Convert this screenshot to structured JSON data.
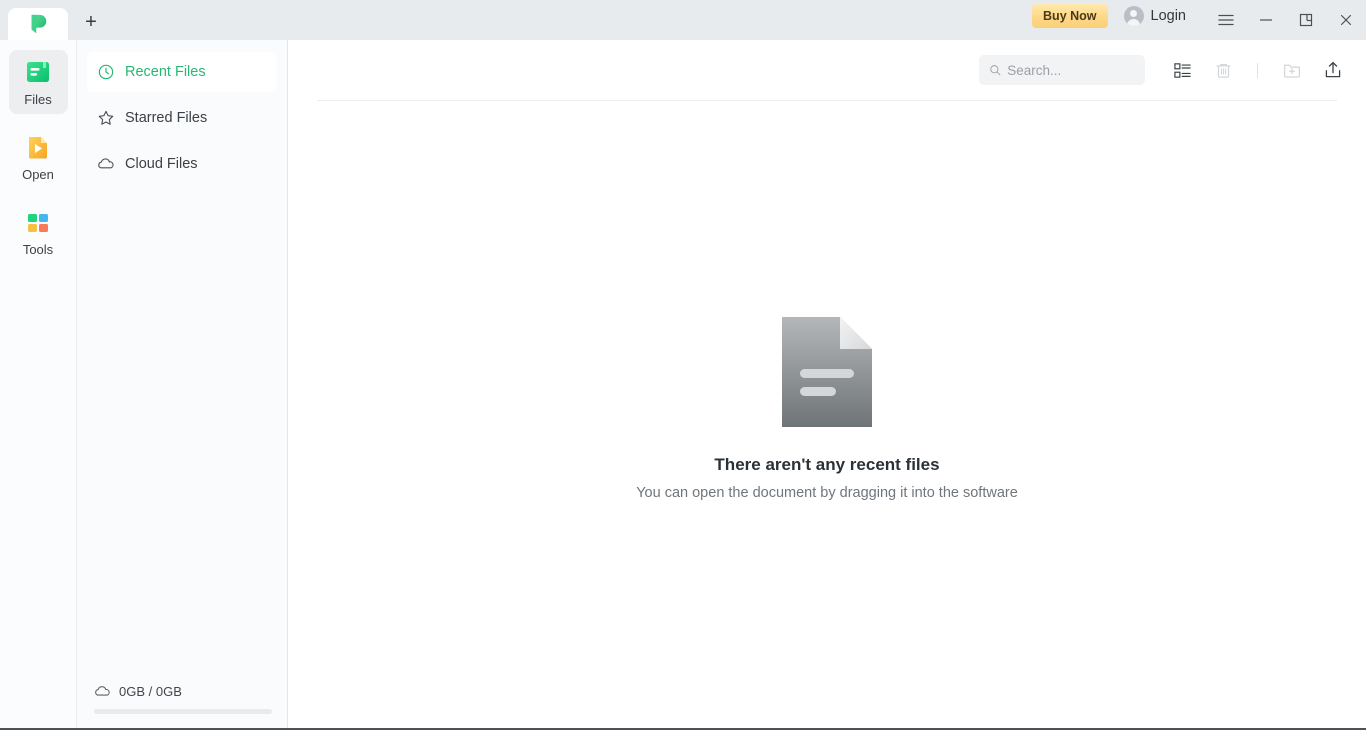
{
  "titlebar": {
    "tab_logo_name": "app-logo",
    "new_tab_label": "+",
    "buy_now_label": "Buy Now",
    "login_label": "Login",
    "menu_icon": "hamburger-menu-icon",
    "minimize_icon": "minimize-icon",
    "restore_icon": "restore-icon",
    "close_icon": "close-icon",
    "bg_color": "#e8ebee",
    "buy_now_color": "#ffd98a"
  },
  "rail": {
    "items": [
      {
        "label": "Files",
        "icon": "files-icon",
        "active": true
      },
      {
        "label": "Open",
        "icon": "open-folder-icon",
        "active": false
      },
      {
        "label": "Tools",
        "icon": "tools-grid-icon",
        "active": false
      }
    ]
  },
  "sidebar": {
    "nav": [
      {
        "label": "Recent Files",
        "icon": "clock-icon",
        "active": true
      },
      {
        "label": "Starred Files",
        "icon": "star-icon",
        "active": false
      },
      {
        "label": "Cloud Files",
        "icon": "cloud-icon",
        "active": false
      }
    ],
    "storage": {
      "icon": "cloud-icon",
      "text": "0GB / 0GB",
      "used_percent": 0
    },
    "accent_color": "#25b974"
  },
  "toolbar": {
    "search_placeholder": "Search...",
    "search_value": "",
    "search_icon": "search-icon",
    "list_view_icon": "list-view-icon",
    "delete_icon": "trash-icon",
    "new_folder_icon": "new-folder-icon",
    "upload_icon": "upload-icon"
  },
  "main": {
    "empty_state": {
      "icon": "document-placeholder-icon",
      "title": "There aren't any recent files",
      "subtitle": "You can open the document by dragging it into the software"
    }
  }
}
